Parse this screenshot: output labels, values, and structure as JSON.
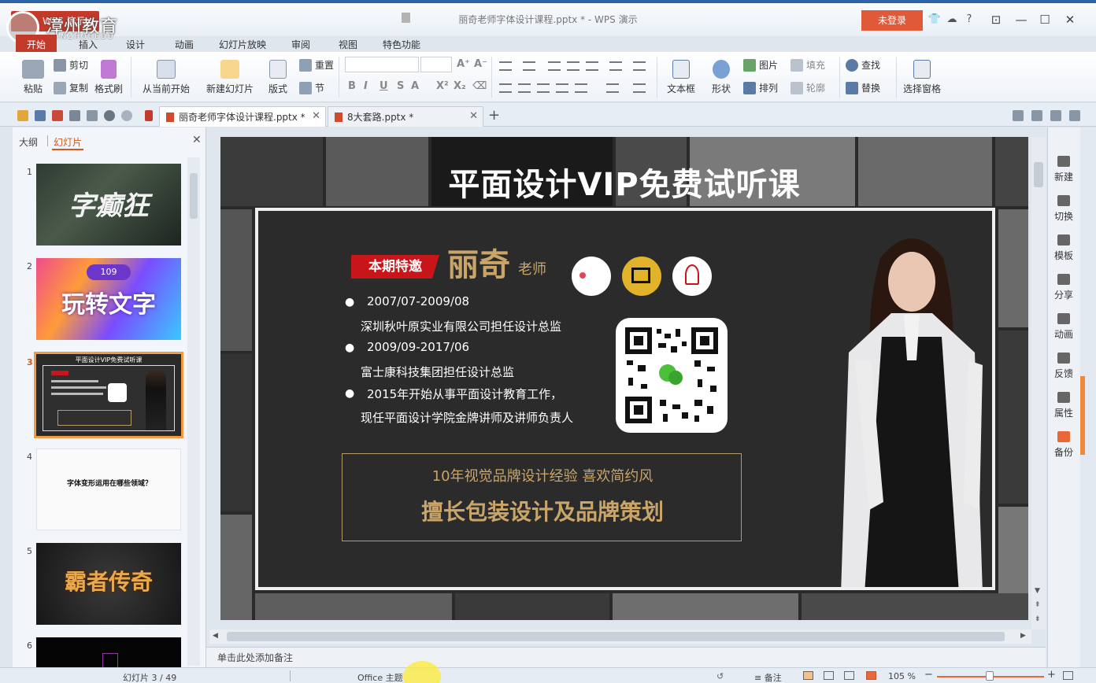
{
  "window": {
    "title": "丽奇老师字体设计课程.pptx * - WPS 演示",
    "login_label": "未登录",
    "logo_cn": "漳州教育",
    "logo_en": "TANZHOUEDU",
    "wps_label": "WPS 演示"
  },
  "menu": {
    "tabs": [
      "开始",
      "插入",
      "设计",
      "动画",
      "幻灯片放映",
      "审阅",
      "视图",
      "特色功能"
    ]
  },
  "ribbon": {
    "paste": "粘贴",
    "cut": "剪切",
    "copy": "复制",
    "format_painter": "格式刷",
    "from_current": "从当前开始",
    "new_slide": "新建幻灯片",
    "layout": "版式",
    "reset": "重置",
    "section": "节",
    "textbox": "文本框",
    "shape": "形状",
    "picture": "图片",
    "fill": "填充",
    "arrange": "排列",
    "outline": "轮廓",
    "find": "查找",
    "replace": "替换",
    "selection_pane": "选择窗格"
  },
  "doc_tabs": [
    {
      "label": "丽奇老师字体设计课程.pptx *",
      "active": true
    },
    {
      "label": "8大套路.pptx *",
      "active": false
    }
  ],
  "panel": {
    "tab_outline": "大纲",
    "tab_slides": "幻灯片",
    "thumbs": [
      {
        "num": "1",
        "text": "字癫狂"
      },
      {
        "num": "2",
        "text": "玩转文字"
      },
      {
        "num": "3",
        "text": "平面设计VIP免费试听课"
      },
      {
        "num": "4",
        "text": "字体变形运用在哪些领域？"
      },
      {
        "num": "5",
        "text": "霸者传奇"
      },
      {
        "num": "6",
        "text": ""
      }
    ]
  },
  "slide": {
    "title": "平面设计VIP免费试听课",
    "banner": "本期特邀",
    "name": "丽奇",
    "honorific": "老师",
    "bullets": [
      {
        "line1": "2007/07-2009/08",
        "line2": "深圳秋叶原实业有限公司担任设计总监"
      },
      {
        "line1": "2009/09-2017/06",
        "line2": "富士康科技集团担任设计总监"
      },
      {
        "line1": "2015年开始从事平面设计教育工作，",
        "line2": "现任平面设计学院金牌讲师及讲师负责人"
      }
    ],
    "box_line1": "10年视觉品牌设计经验 喜欢简约风",
    "box_line2": "擅长包装设计及品牌策划"
  },
  "notes_placeholder": "单击此处添加备注",
  "right_sidebar": [
    "新建",
    "切换",
    "模板",
    "分享",
    "动画",
    "反馈",
    "属性",
    "备份"
  ],
  "status": {
    "slide_count": "幻灯片 3 / 49",
    "theme": "Office 主题",
    "notes": "备注",
    "zoom": "105 %"
  },
  "colors": {
    "accent": "#c43a2a",
    "gold": "#c9a56a",
    "selection": "#f39a45"
  }
}
